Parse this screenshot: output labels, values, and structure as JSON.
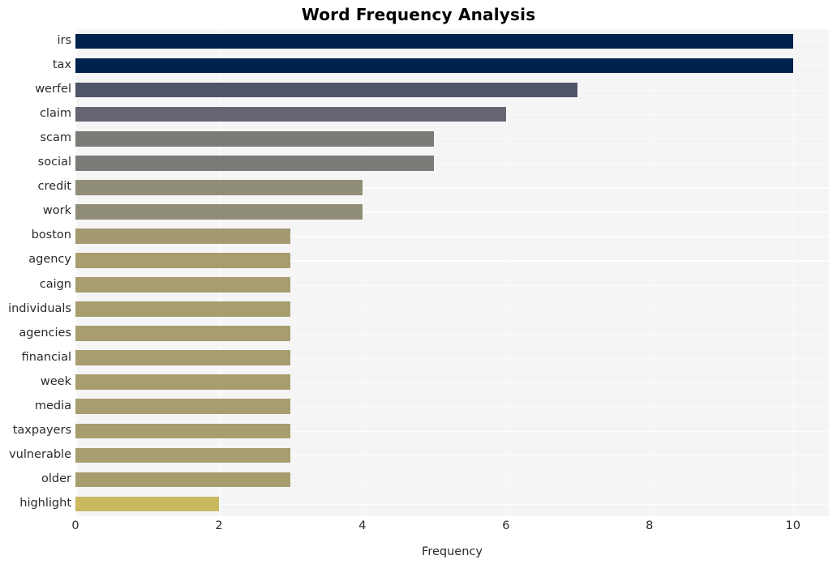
{
  "chart_data": {
    "type": "bar",
    "orientation": "horizontal",
    "title": "Word Frequency Analysis",
    "xlabel": "Frequency",
    "ylabel": "",
    "xlim": [
      0,
      10.5
    ],
    "xticks": [
      0,
      2,
      4,
      6,
      8,
      10
    ],
    "xtick_labels": [
      "0",
      "2",
      "4",
      "6",
      "8",
      "10"
    ],
    "grid": true,
    "grid_axis": "both",
    "legend": null,
    "background": "#f5f5f6",
    "categories": [
      "irs",
      "tax",
      "werfel",
      "claim",
      "scam",
      "social",
      "credit",
      "work",
      "boston",
      "agency",
      "caign",
      "individuals",
      "agencies",
      "financial",
      "week",
      "media",
      "taxpayers",
      "vulnerable",
      "older",
      "highlight"
    ],
    "values": [
      10,
      10,
      7,
      6,
      5,
      5,
      4,
      4,
      3,
      3,
      3,
      3,
      3,
      3,
      3,
      3,
      3,
      3,
      3,
      2
    ],
    "bar_colors": [
      "#00224e",
      "#00224e",
      "#4f5568",
      "#666672",
      "#7b7a77",
      "#7b7a77",
      "#908d77",
      "#908d77",
      "#a49a71",
      "#a79d6f",
      "#a79d6f",
      "#a79d6f",
      "#a79d6f",
      "#a79d6f",
      "#a79d6f",
      "#a79d6f",
      "#a79d6f",
      "#a79d6f",
      "#a79d6f",
      "#cbb95f"
    ],
    "colormap": "cividis"
  },
  "accent_colors": {
    "title_text": "#000000",
    "tick_text": "#2b2b2b",
    "plot_background": "#f5f5f6",
    "gridline": "#fbfbfc",
    "figure_background": "#ffffff"
  }
}
